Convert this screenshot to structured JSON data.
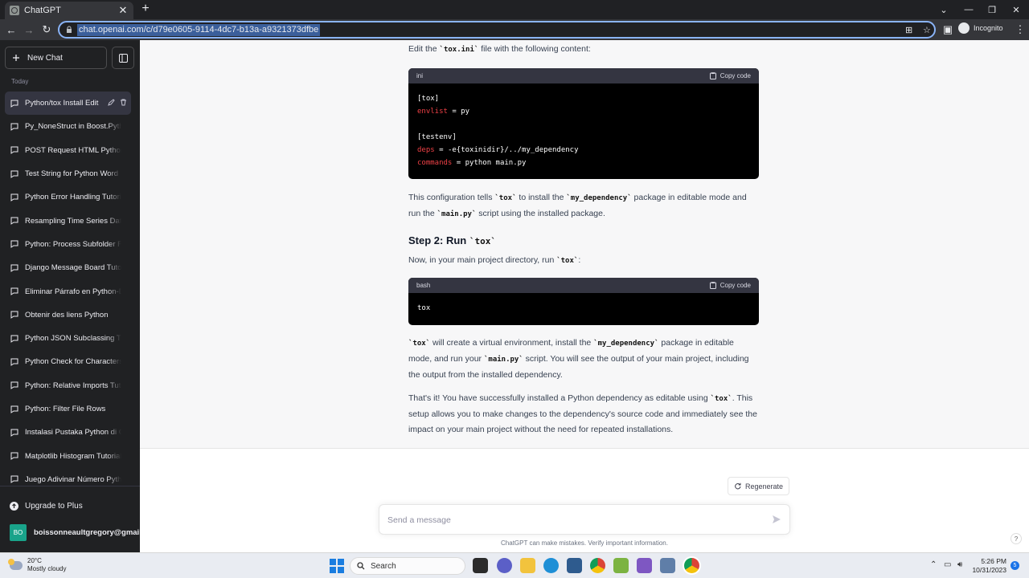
{
  "browser": {
    "tab_title": "ChatGPT",
    "tab_close": "✕",
    "new_tab": "+",
    "url": "chat.openai.com/c/d79e0605-9114-4dc7-b13a-a9321373dfbe",
    "profile_label": "Incognito"
  },
  "sidebar": {
    "new_chat_label": "New Chat",
    "section_label": "Today",
    "items": [
      {
        "label": "Python/tox Install Edit"
      },
      {
        "label": "Py_NoneStruct in Boost.Python"
      },
      {
        "label": "POST Request HTML Python"
      },
      {
        "label": "Test String for Python Word"
      },
      {
        "label": "Python Error Handling Tutorial"
      },
      {
        "label": "Resampling Time Series Data"
      },
      {
        "label": "Python: Process Subfolder Files"
      },
      {
        "label": "Django Message Board Tutorial"
      },
      {
        "label": "Eliminar Párrafo en Python-Docx"
      },
      {
        "label": "Obtenir des liens Python"
      },
      {
        "label": "Python JSON Subclassing Tutorial"
      },
      {
        "label": "Python Check for Characters"
      },
      {
        "label": "Python: Relative Imports Tutorial"
      },
      {
        "label": "Python: Filter File Rows"
      },
      {
        "label": "Instalasi Pustaka Python di Colab"
      },
      {
        "label": "Matplotlib Histogram Tutorial"
      },
      {
        "label": "Juego Adivinar Número Python"
      }
    ],
    "upgrade_label": "Upgrade to Plus",
    "user_initials": "BO",
    "user_name": "boissonneaultgregory@gmail"
  },
  "main": {
    "intro": {
      "pre": "Edit the ",
      "code": "`tox.ini`",
      "post": " file with the following content:"
    },
    "code1": {
      "lang": "ini",
      "copy_label": "Copy code",
      "lines": [
        "[tox]",
        "envlist",
        " = py",
        "",
        "[testenv]",
        "deps",
        " = -e{toxinidir}/../my_dependency",
        "commands",
        " = python main.py"
      ]
    },
    "para1": {
      "t1": "This configuration tells ",
      "c1": "`tox`",
      "t2": " to install the ",
      "c2": "`my_dependency`",
      "t3": " package in editable mode and run the ",
      "c3": "`main.py`",
      "t4": " script using the installed package."
    },
    "step2": {
      "text": "Step 2: Run ",
      "code": "`tox`"
    },
    "para2": {
      "pre": "Now, in your main project directory, run ",
      "code": "`tox`",
      "post": ":"
    },
    "code2": {
      "lang": "bash",
      "copy_label": "Copy code",
      "body": "tox"
    },
    "para3": {
      "c1": "`tox`",
      "t1": " will create a virtual environment, install the ",
      "c2": "`my_dependency`",
      "t2": " package in editable mode, and run your ",
      "c3": "`main.py`",
      "t3": " script. You will see the output of your main project, including the output from the installed dependency."
    },
    "para4": {
      "t1": "That's it! You have successfully installed a Python dependency as editable using ",
      "c1": "`tox`",
      "t2": ". This setup allows you to make changes to the dependency's source code and immediately see the impact on your main project without the need for repeated installations."
    },
    "regenerate_label": "Regenerate",
    "message_placeholder": "Send a message",
    "disclaimer": "ChatGPT can make mistakes. Verify important information.",
    "help": "?"
  },
  "taskbar": {
    "temp": "20°C",
    "weather": "Mostly cloudy",
    "search_label": "Search",
    "time": "5:26 PM",
    "date": "10/31/2023",
    "notifications": "5"
  },
  "colors": {
    "sidebar_bg": "#202123",
    "code_keyword": "#ef4146",
    "accent": "#8ab4f8"
  }
}
